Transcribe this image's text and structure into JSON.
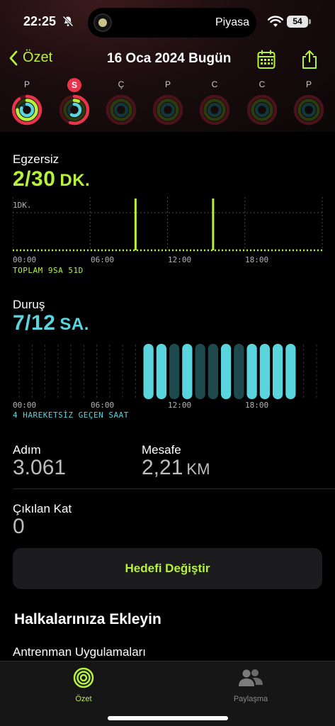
{
  "status": {
    "time": "22:25",
    "island_text": "Piyasa",
    "battery": "54"
  },
  "nav": {
    "back_label": "Özet",
    "title": "16 Oca 2024 Bugün"
  },
  "days": [
    {
      "letter": "P",
      "active": false,
      "move": 0.9,
      "exercise": 0.75,
      "stand": 0.8
    },
    {
      "letter": "S",
      "active": true,
      "move": 0.55,
      "exercise": 0.07,
      "stand": 0.58
    },
    {
      "letter": "Ç",
      "active": false,
      "move": 0,
      "exercise": 0,
      "stand": 0
    },
    {
      "letter": "P",
      "active": false,
      "move": 0,
      "exercise": 0,
      "stand": 0
    },
    {
      "letter": "C",
      "active": false,
      "move": 0,
      "exercise": 0,
      "stand": 0
    },
    {
      "letter": "C",
      "active": false,
      "move": 0,
      "exercise": 0,
      "stand": 0
    },
    {
      "letter": "P",
      "active": false,
      "move": 0,
      "exercise": 0,
      "stand": 0
    }
  ],
  "exercise": {
    "label": "Egzersiz",
    "value": "2/30",
    "unit": "DK.",
    "y_label": "1DK.",
    "total": "TOPLAM 9SA 51D",
    "ticks": [
      "00:00",
      "06:00",
      "12:00",
      "18:00"
    ]
  },
  "stand": {
    "label": "Duruş",
    "value": "7/12",
    "unit": "SA.",
    "note": "4 HAREKETSİZ GEÇEN SAAT",
    "ticks": [
      "00:00",
      "06:00",
      "12:00",
      "18:00"
    ]
  },
  "chart_data": [
    {
      "type": "bar",
      "title": "Egzersiz",
      "ylabel": "1DK.",
      "x_ticks": [
        "00:00",
        "06:00",
        "12:00",
        "18:00"
      ],
      "x": [
        9.5,
        15.5
      ],
      "values": [
        1,
        1
      ]
    },
    {
      "type": "bar",
      "title": "Duruş",
      "x_ticks": [
        "00:00",
        "06:00",
        "12:00",
        "18:00"
      ],
      "categories": [
        10,
        11,
        12,
        13,
        14,
        15,
        16,
        17,
        18,
        19,
        20,
        21
      ],
      "stood": [
        1,
        1,
        0,
        1,
        0,
        0,
        1,
        0,
        1,
        1,
        1,
        1
      ]
    }
  ],
  "metrics": {
    "steps_label": "Adım",
    "steps_value": "3.061",
    "distance_label": "Mesafe",
    "distance_value": "2,21",
    "distance_unit": "KM",
    "floors_label": "Çıkılan Kat",
    "floors_value": "0"
  },
  "change_goal_label": "Hedefi Değiştir",
  "add_heading": "Halkalarınıza Ekleyin",
  "workouts_label": "Antrenman Uygulamaları",
  "tabs": [
    {
      "label": "Özet",
      "active": true
    },
    {
      "label": "Paylaşma",
      "active": false
    }
  ],
  "colors": {
    "exercise": "#b6f23a",
    "stand": "#5ad4dd",
    "move": "#e8344b",
    "accent": "#b6f23a"
  }
}
